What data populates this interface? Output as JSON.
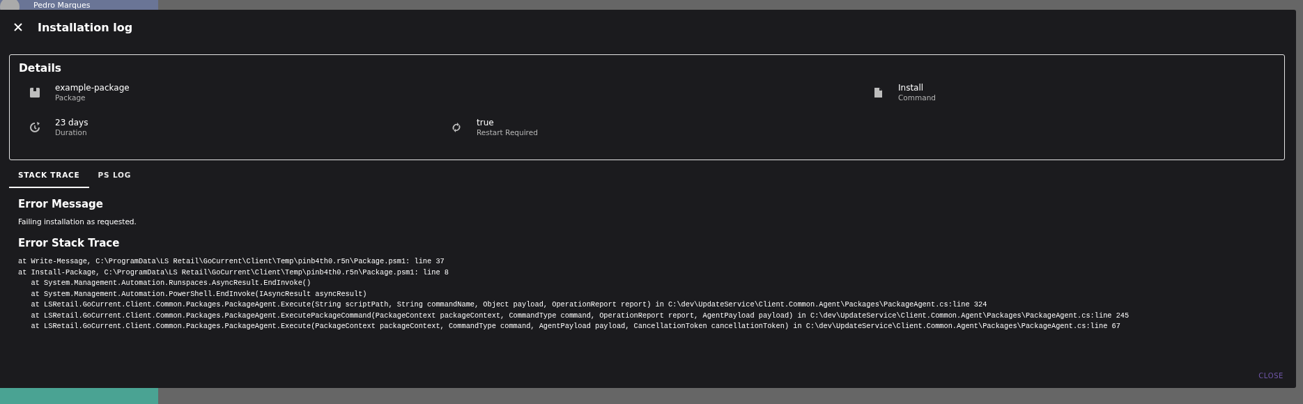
{
  "backdrop": {
    "user_name": "Pedro Marques"
  },
  "dialog": {
    "title": "Installation log",
    "details": {
      "title": "Details",
      "rows": [
        {
          "items": [
            {
              "kind": "package",
              "value": "example-package",
              "label": "Package"
            },
            {
              "kind": "command",
              "value": "Install",
              "label": "Command"
            }
          ]
        },
        {
          "items": [
            {
              "kind": "duration",
              "value": "23 days",
              "label": "Duration"
            },
            {
              "kind": "restart",
              "value": "true",
              "label": "Restart Required"
            }
          ]
        }
      ]
    },
    "tabs": [
      {
        "label": "STACK TRACE",
        "selected": true
      },
      {
        "label": "PS LOG",
        "selected": false
      }
    ],
    "error_message": {
      "title": "Error Message",
      "text": "Failing installation as requested."
    },
    "stack_trace": {
      "title": "Error Stack Trace",
      "lines": [
        "at Write-Message, C:\\ProgramData\\LS Retail\\GoCurrent\\Client\\Temp\\pinb4th0.r5n\\Package.psm1: line 37",
        "at Install-Package, C:\\ProgramData\\LS Retail\\GoCurrent\\Client\\Temp\\pinb4th0.r5n\\Package.psm1: line 8",
        "   at System.Management.Automation.Runspaces.AsyncResult.EndInvoke()",
        "   at System.Management.Automation.PowerShell.EndInvoke(IAsyncResult asyncResult)",
        "   at LSRetail.GoCurrent.Client.Common.Packages.PackageAgent.Execute(String scriptPath, String commandName, Object payload, OperationReport report) in C:\\dev\\UpdateService\\Client.Common.Agent\\Packages\\PackageAgent.cs:line 324",
        "   at LSRetail.GoCurrent.Client.Common.Packages.PackageAgent.ExecutePackageCommand(PackageContext packageContext, CommandType command, OperationReport report, AgentPayload payload) in C:\\dev\\UpdateService\\Client.Common.Agent\\Packages\\PackageAgent.cs:line 245",
        "   at LSRetail.GoCurrent.Client.Common.Packages.PackageAgent.Execute(PackageContext packageContext, CommandType command, AgentPayload payload, CancellationToken cancellationToken) in C:\\dev\\UpdateService\\Client.Common.Agent\\Packages\\PackageAgent.cs:line 67"
      ]
    },
    "close_button": "CLOSE"
  }
}
